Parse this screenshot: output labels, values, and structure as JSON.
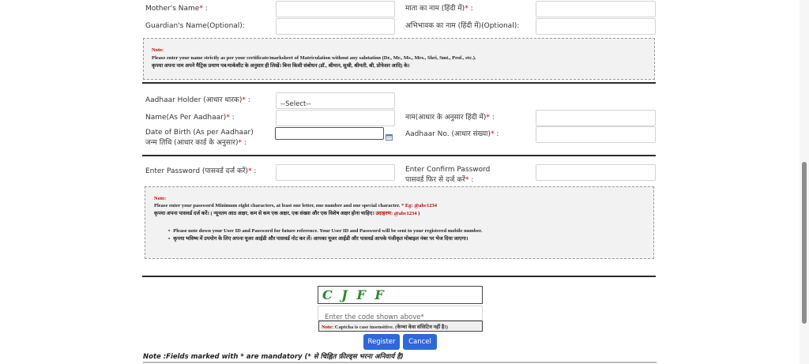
{
  "personal": {
    "mother_name_label": "Mother's Name",
    "mother_name_hindi_label": "माता का नाम (हिंदी में)",
    "guardian_name_label": "Guardian's Name(Optional):",
    "guardian_name_hindi_label": "अभिभावक का नाम (हिंदी में)(Optional):"
  },
  "name_note": {
    "title": "Note:",
    "line1": "Please enter your name strictly as per your certificate/marksheet of Matriculation without any salutation (Dr., Mr., Ms., Mrs., Shri, Smt., Prof., etc.).",
    "line2": "कृपया अपना नाम अपने मैट्रिक प्रमाण पत्र/मार्कशीट के अनुसार ही लिखें। बिना किसी संबोधन (डॉ., श्रीमान, सुश्री, श्रीमती, श्री, प्रोफेसर आदि) के।"
  },
  "aadhaar": {
    "holder_label": "Aadhaar Holder (आधार धारक)",
    "holder_select": "--Select--",
    "name_label": "Name(As Per Aadhaar)",
    "name_hindi_label": "नाम(आधार के अनुसार हिंदी में)",
    "dob_label_line1": "Date of Birth (As per Aadhaar)",
    "dob_label_line2": "जन्म तिथि (आधार कार्ड के अनुसार)",
    "number_label": "Aadhaar No. (आधार संख्या)"
  },
  "password": {
    "enter_label": "Enter Password (पासवर्ड दर्ज करें)",
    "confirm_label_line1": "Enter Confirm Password",
    "confirm_label_line2": "पासवर्ड फिर से दर्ज करें"
  },
  "password_note": {
    "title": "Note:",
    "line1": "Please enter your password Minimum eight characters, at least one letter, one number and one special character.",
    "line1_example": " * Eg: @abc1234",
    "line2": "कृपया अपना पासवर्ड दर्ज करें। ( न्यूनतम आठ अक्षर, कम से कम एक अक्षर, एक संख्या और एक विशेष अक्षर होना चाहिए। ",
    "line2_example": "उदाहरण: @abc1234",
    "line2_end": " )",
    "bullet1": "Please note down your User ID and Password for future reference. Your User ID and Password will be sent to your registered mobile number.",
    "bullet2": "कृपया भविष्य में उपयोग के लिए अपना यूजर आईडी और पासवर्ड नोट कर लें। आपका यूजर आईडी और पासवर्ड आपके पंजीकृत मोबाइल नंबर पर भेज दिया जाएगा।"
  },
  "captcha": {
    "text": "C J F F",
    "input_placeholder": "Enter the code shown above*",
    "note_label": "Note: ",
    "note_text": "Captcha is case insensitive. (केप्चा केस संसिटिव नहीं है।)"
  },
  "buttons": {
    "register": "Register",
    "cancel": "Cancel"
  },
  "footer": {
    "mandatory_note": "Note :Fields marked with * are mandatory (* से चिह्नित फ़ील्ड्स भरना अनिवार्य है)"
  },
  "colors": {
    "required": "#e00000",
    "button": "#2f68d8",
    "captcha_text": "#2a8a2a"
  },
  "icons": {
    "calendar": "calendar-icon"
  }
}
